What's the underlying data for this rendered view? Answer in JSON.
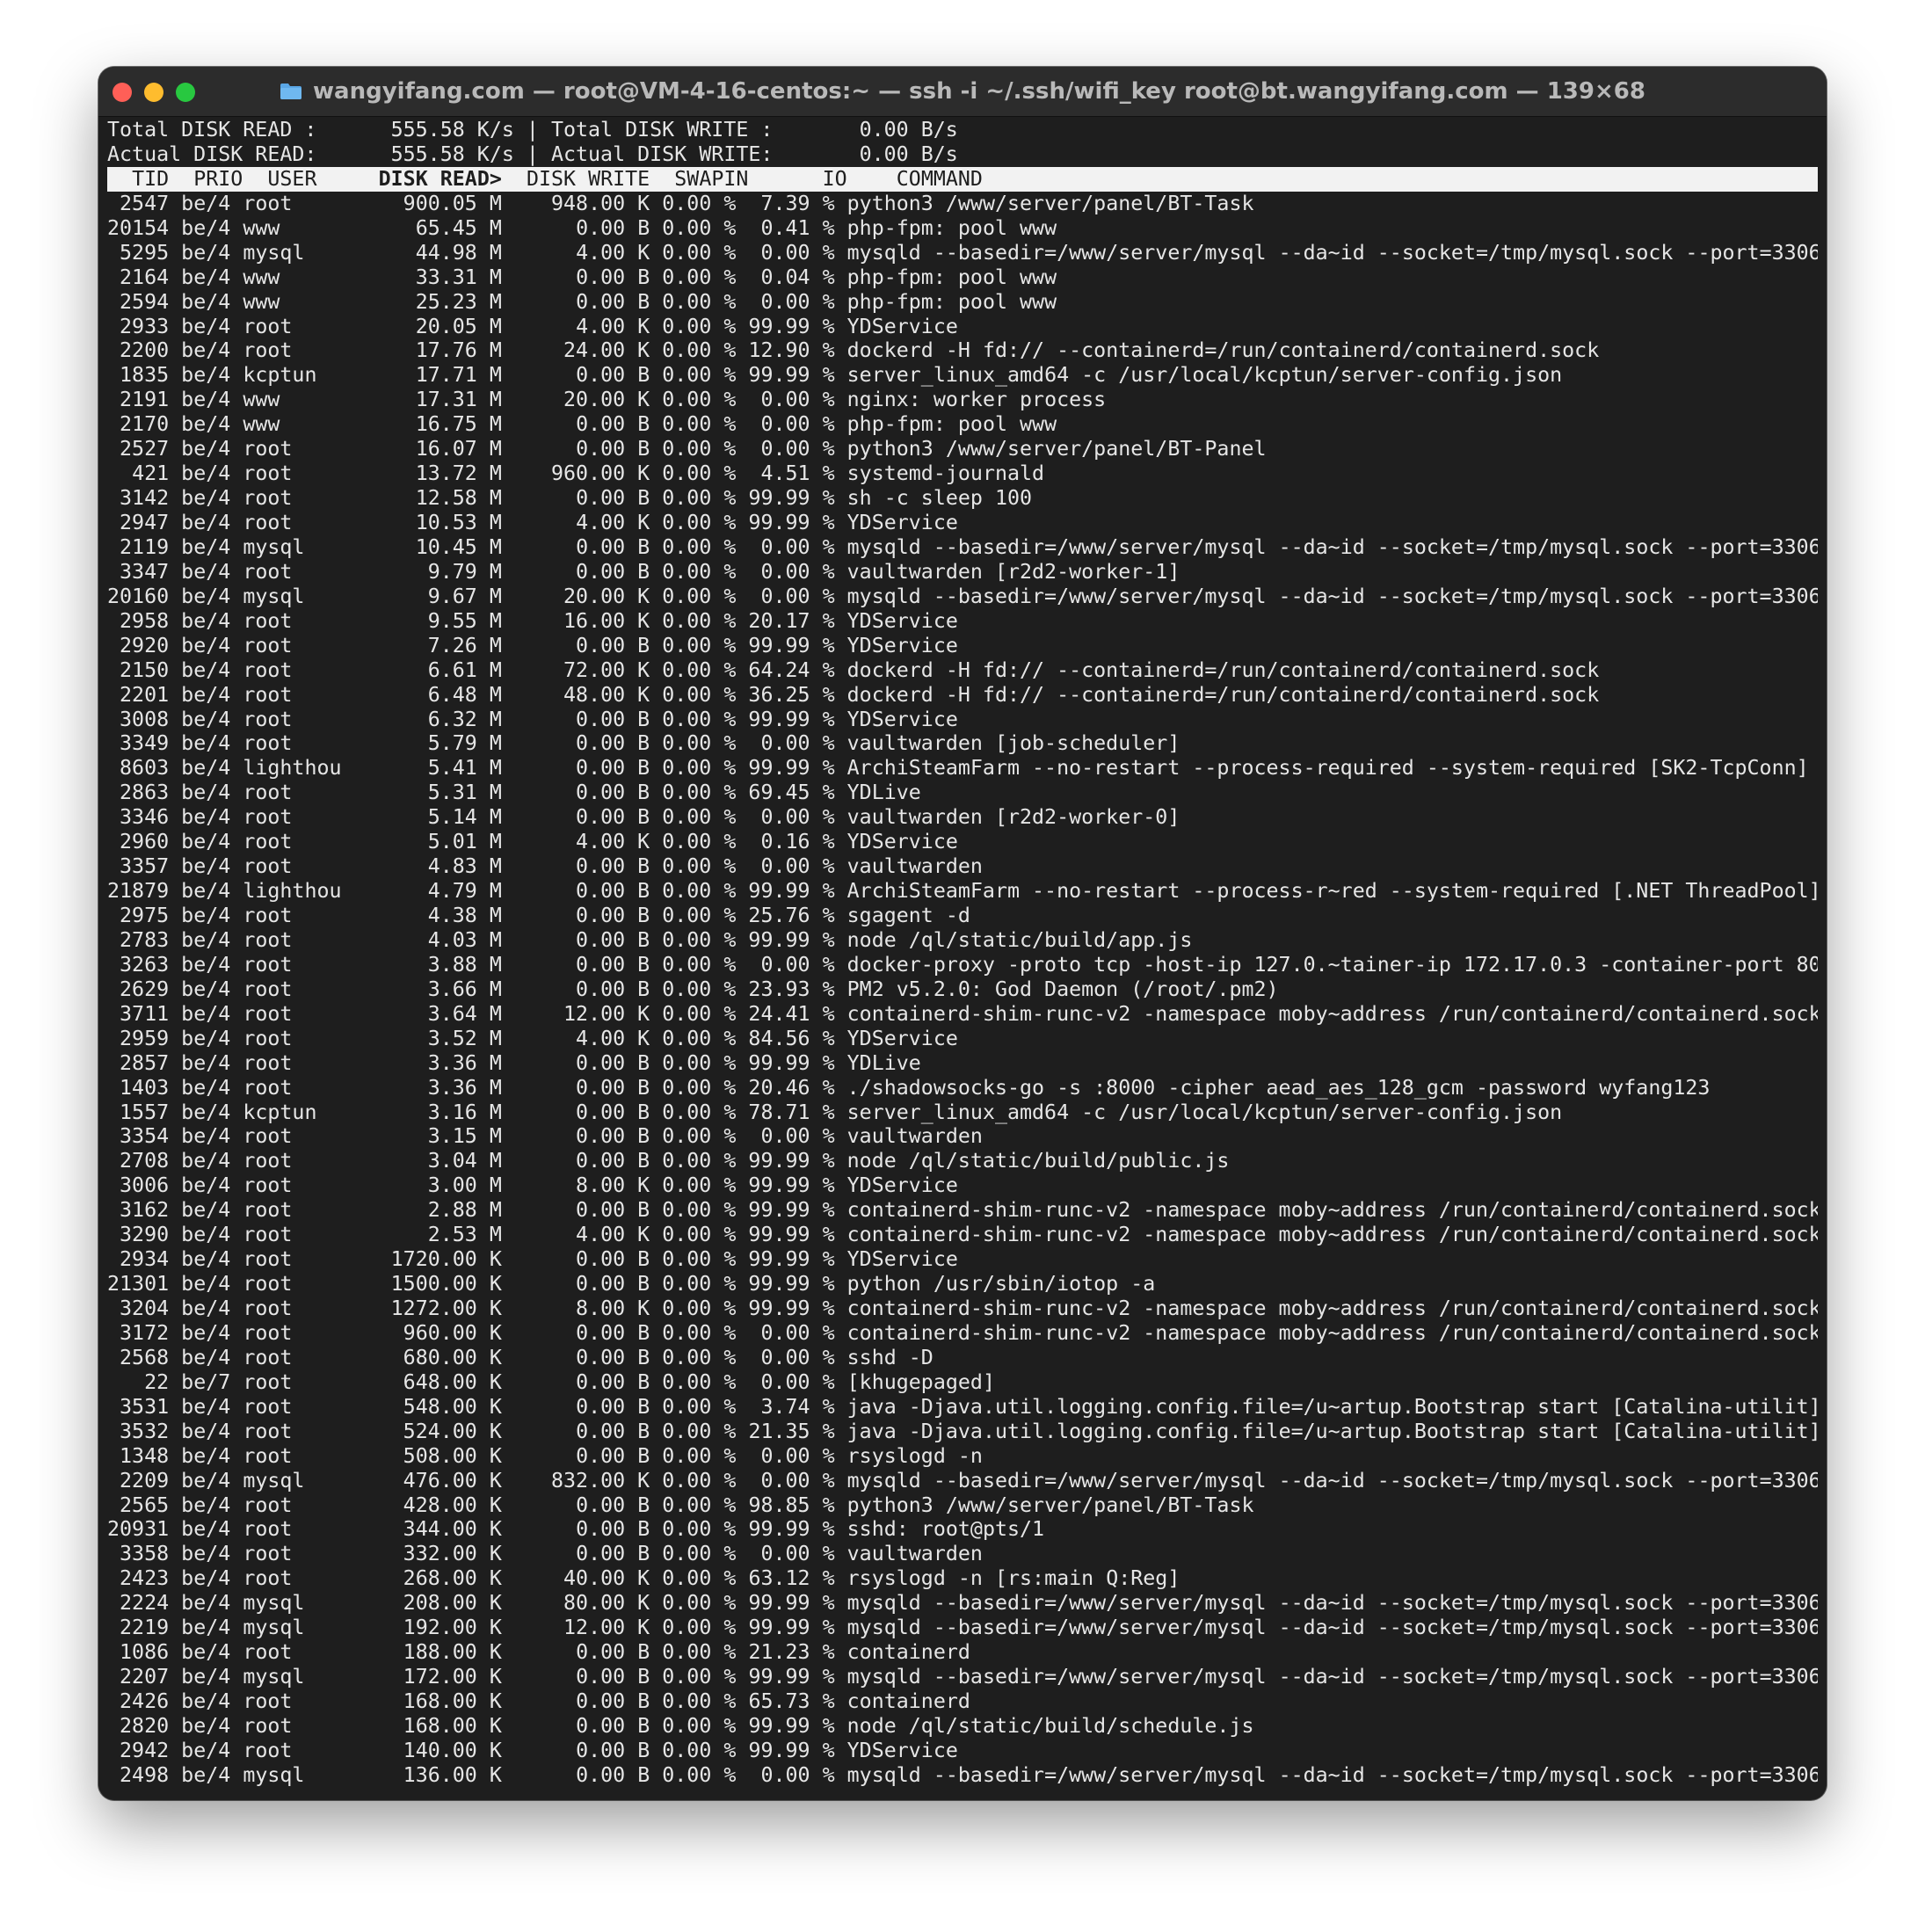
{
  "window": {
    "title": "wangyifang.com — root@VM-4-16-centos:~ — ssh -i ~/.ssh/wifi_key root@bt.wangyifang.com — 139×68"
  },
  "summary": {
    "total_read_label": "Total DISK READ :",
    "total_read_value": "555.58 K/s",
    "total_write_label": "Total DISK WRITE :",
    "total_write_value": "0.00 B/s",
    "actual_read_label": "Actual DISK READ:",
    "actual_read_value": "555.58 K/s",
    "actual_write_label": "Actual DISK WRITE:",
    "actual_write_value": "0.00 B/s"
  },
  "columns": {
    "tid": "TID",
    "prio": "PRIO",
    "user": "USER",
    "disk_read": "DISK READ>",
    "disk_write": "DISK WRITE",
    "swapin": "SWAPIN",
    "io": "IO",
    "command": "COMMAND"
  },
  "rows": [
    {
      "tid": "2547",
      "prio": "be/4",
      "user": "root",
      "read": "900.05 M",
      "write": "948.00 K",
      "swapin": "0.00 %",
      "io": "7.39 %",
      "command": "python3 /www/server/panel/BT-Task"
    },
    {
      "tid": "20154",
      "prio": "be/4",
      "user": "www",
      "read": "65.45 M",
      "write": "0.00 B",
      "swapin": "0.00 %",
      "io": "0.41 %",
      "command": "php-fpm: pool www"
    },
    {
      "tid": "5295",
      "prio": "be/4",
      "user": "mysql",
      "read": "44.98 M",
      "write": "4.00 K",
      "swapin": "0.00 %",
      "io": "0.00 %",
      "command": "mysqld --basedir=/www/server/mysql --da~id --socket=/tmp/mysql.sock --port=3306"
    },
    {
      "tid": "2164",
      "prio": "be/4",
      "user": "www",
      "read": "33.31 M",
      "write": "0.00 B",
      "swapin": "0.00 %",
      "io": "0.04 %",
      "command": "php-fpm: pool www"
    },
    {
      "tid": "2594",
      "prio": "be/4",
      "user": "www",
      "read": "25.23 M",
      "write": "0.00 B",
      "swapin": "0.00 %",
      "io": "0.00 %",
      "command": "php-fpm: pool www"
    },
    {
      "tid": "2933",
      "prio": "be/4",
      "user": "root",
      "read": "20.05 M",
      "write": "4.00 K",
      "swapin": "0.00 %",
      "io": "99.99 %",
      "command": "YDService"
    },
    {
      "tid": "2200",
      "prio": "be/4",
      "user": "root",
      "read": "17.76 M",
      "write": "24.00 K",
      "swapin": "0.00 %",
      "io": "12.90 %",
      "command": "dockerd -H fd:// --containerd=/run/containerd/containerd.sock"
    },
    {
      "tid": "1835",
      "prio": "be/4",
      "user": "kcptun",
      "read": "17.71 M",
      "write": "0.00 B",
      "swapin": "0.00 %",
      "io": "99.99 %",
      "command": "server_linux_amd64 -c /usr/local/kcptun/server-config.json"
    },
    {
      "tid": "2191",
      "prio": "be/4",
      "user": "www",
      "read": "17.31 M",
      "write": "20.00 K",
      "swapin": "0.00 %",
      "io": "0.00 %",
      "command": "nginx: worker process"
    },
    {
      "tid": "2170",
      "prio": "be/4",
      "user": "www",
      "read": "16.75 M",
      "write": "0.00 B",
      "swapin": "0.00 %",
      "io": "0.00 %",
      "command": "php-fpm: pool www"
    },
    {
      "tid": "2527",
      "prio": "be/4",
      "user": "root",
      "read": "16.07 M",
      "write": "0.00 B",
      "swapin": "0.00 %",
      "io": "0.00 %",
      "command": "python3 /www/server/panel/BT-Panel"
    },
    {
      "tid": "421",
      "prio": "be/4",
      "user": "root",
      "read": "13.72 M",
      "write": "960.00 K",
      "swapin": "0.00 %",
      "io": "4.51 %",
      "command": "systemd-journald"
    },
    {
      "tid": "3142",
      "prio": "be/4",
      "user": "root",
      "read": "12.58 M",
      "write": "0.00 B",
      "swapin": "0.00 %",
      "io": "99.99 %",
      "command": "sh -c sleep 100"
    },
    {
      "tid": "2947",
      "prio": "be/4",
      "user": "root",
      "read": "10.53 M",
      "write": "4.00 K",
      "swapin": "0.00 %",
      "io": "99.99 %",
      "command": "YDService"
    },
    {
      "tid": "2119",
      "prio": "be/4",
      "user": "mysql",
      "read": "10.45 M",
      "write": "0.00 B",
      "swapin": "0.00 %",
      "io": "0.00 %",
      "command": "mysqld --basedir=/www/server/mysql --da~id --socket=/tmp/mysql.sock --port=3306"
    },
    {
      "tid": "3347",
      "prio": "be/4",
      "user": "root",
      "read": "9.79 M",
      "write": "0.00 B",
      "swapin": "0.00 %",
      "io": "0.00 %",
      "command": "vaultwarden [r2d2-worker-1]"
    },
    {
      "tid": "20160",
      "prio": "be/4",
      "user": "mysql",
      "read": "9.67 M",
      "write": "20.00 K",
      "swapin": "0.00 %",
      "io": "0.00 %",
      "command": "mysqld --basedir=/www/server/mysql --da~id --socket=/tmp/mysql.sock --port=3306"
    },
    {
      "tid": "2958",
      "prio": "be/4",
      "user": "root",
      "read": "9.55 M",
      "write": "16.00 K",
      "swapin": "0.00 %",
      "io": "20.17 %",
      "command": "YDService"
    },
    {
      "tid": "2920",
      "prio": "be/4",
      "user": "root",
      "read": "7.26 M",
      "write": "0.00 B",
      "swapin": "0.00 %",
      "io": "99.99 %",
      "command": "YDService"
    },
    {
      "tid": "2150",
      "prio": "be/4",
      "user": "root",
      "read": "6.61 M",
      "write": "72.00 K",
      "swapin": "0.00 %",
      "io": "64.24 %",
      "command": "dockerd -H fd:// --containerd=/run/containerd/containerd.sock"
    },
    {
      "tid": "2201",
      "prio": "be/4",
      "user": "root",
      "read": "6.48 M",
      "write": "48.00 K",
      "swapin": "0.00 %",
      "io": "36.25 %",
      "command": "dockerd -H fd:// --containerd=/run/containerd/containerd.sock"
    },
    {
      "tid": "3008",
      "prio": "be/4",
      "user": "root",
      "read": "6.32 M",
      "write": "0.00 B",
      "swapin": "0.00 %",
      "io": "99.99 %",
      "command": "YDService"
    },
    {
      "tid": "3349",
      "prio": "be/4",
      "user": "root",
      "read": "5.79 M",
      "write": "0.00 B",
      "swapin": "0.00 %",
      "io": "0.00 %",
      "command": "vaultwarden [job-scheduler]"
    },
    {
      "tid": "8603",
      "prio": "be/4",
      "user": "lighthou",
      "read": "5.41 M",
      "write": "0.00 B",
      "swapin": "0.00 %",
      "io": "99.99 %",
      "command": "ArchiSteamFarm --no-restart --process-required --system-required [SK2-TcpConn]"
    },
    {
      "tid": "2863",
      "prio": "be/4",
      "user": "root",
      "read": "5.31 M",
      "write": "0.00 B",
      "swapin": "0.00 %",
      "io": "69.45 %",
      "command": "YDLive"
    },
    {
      "tid": "3346",
      "prio": "be/4",
      "user": "root",
      "read": "5.14 M",
      "write": "0.00 B",
      "swapin": "0.00 %",
      "io": "0.00 %",
      "command": "vaultwarden [r2d2-worker-0]"
    },
    {
      "tid": "2960",
      "prio": "be/4",
      "user": "root",
      "read": "5.01 M",
      "write": "4.00 K",
      "swapin": "0.00 %",
      "io": "0.16 %",
      "command": "YDService"
    },
    {
      "tid": "3357",
      "prio": "be/4",
      "user": "root",
      "read": "4.83 M",
      "write": "0.00 B",
      "swapin": "0.00 %",
      "io": "0.00 %",
      "command": "vaultwarden"
    },
    {
      "tid": "21879",
      "prio": "be/4",
      "user": "lighthou",
      "read": "4.79 M",
      "write": "0.00 B",
      "swapin": "0.00 %",
      "io": "99.99 %",
      "command": "ArchiSteamFarm --no-restart --process-r~red --system-required [.NET ThreadPool]"
    },
    {
      "tid": "2975",
      "prio": "be/4",
      "user": "root",
      "read": "4.38 M",
      "write": "0.00 B",
      "swapin": "0.00 %",
      "io": "25.76 %",
      "command": "sgagent -d"
    },
    {
      "tid": "2783",
      "prio": "be/4",
      "user": "root",
      "read": "4.03 M",
      "write": "0.00 B",
      "swapin": "0.00 %",
      "io": "99.99 %",
      "command": "node /ql/static/build/app.js"
    },
    {
      "tid": "3263",
      "prio": "be/4",
      "user": "root",
      "read": "3.88 M",
      "write": "0.00 B",
      "swapin": "0.00 %",
      "io": "0.00 %",
      "command": "docker-proxy -proto tcp -host-ip 127.0.~tainer-ip 172.17.0.3 -container-port 80"
    },
    {
      "tid": "2629",
      "prio": "be/4",
      "user": "root",
      "read": "3.66 M",
      "write": "0.00 B",
      "swapin": "0.00 %",
      "io": "23.93 %",
      "command": "PM2 v5.2.0: God Daemon (/root/.pm2)"
    },
    {
      "tid": "3711",
      "prio": "be/4",
      "user": "root",
      "read": "3.64 M",
      "write": "12.00 K",
      "swapin": "0.00 %",
      "io": "24.41 %",
      "command": "containerd-shim-runc-v2 -namespace moby~address /run/containerd/containerd.sock"
    },
    {
      "tid": "2959",
      "prio": "be/4",
      "user": "root",
      "read": "3.52 M",
      "write": "4.00 K",
      "swapin": "0.00 %",
      "io": "84.56 %",
      "command": "YDService"
    },
    {
      "tid": "2857",
      "prio": "be/4",
      "user": "root",
      "read": "3.36 M",
      "write": "0.00 B",
      "swapin": "0.00 %",
      "io": "99.99 %",
      "command": "YDLive"
    },
    {
      "tid": "1403",
      "prio": "be/4",
      "user": "root",
      "read": "3.36 M",
      "write": "0.00 B",
      "swapin": "0.00 %",
      "io": "20.46 %",
      "command": "./shadowsocks-go -s :8000 -cipher aead_aes_128_gcm -password wyfang123"
    },
    {
      "tid": "1557",
      "prio": "be/4",
      "user": "kcptun",
      "read": "3.16 M",
      "write": "0.00 B",
      "swapin": "0.00 %",
      "io": "78.71 %",
      "command": "server_linux_amd64 -c /usr/local/kcptun/server-config.json"
    },
    {
      "tid": "3354",
      "prio": "be/4",
      "user": "root",
      "read": "3.15 M",
      "write": "0.00 B",
      "swapin": "0.00 %",
      "io": "0.00 %",
      "command": "vaultwarden"
    },
    {
      "tid": "2708",
      "prio": "be/4",
      "user": "root",
      "read": "3.04 M",
      "write": "0.00 B",
      "swapin": "0.00 %",
      "io": "99.99 %",
      "command": "node /ql/static/build/public.js"
    },
    {
      "tid": "3006",
      "prio": "be/4",
      "user": "root",
      "read": "3.00 M",
      "write": "8.00 K",
      "swapin": "0.00 %",
      "io": "99.99 %",
      "command": "YDService"
    },
    {
      "tid": "3162",
      "prio": "be/4",
      "user": "root",
      "read": "2.88 M",
      "write": "0.00 B",
      "swapin": "0.00 %",
      "io": "99.99 %",
      "command": "containerd-shim-runc-v2 -namespace moby~address /run/containerd/containerd.sock"
    },
    {
      "tid": "3290",
      "prio": "be/4",
      "user": "root",
      "read": "2.53 M",
      "write": "4.00 K",
      "swapin": "0.00 %",
      "io": "99.99 %",
      "command": "containerd-shim-runc-v2 -namespace moby~address /run/containerd/containerd.sock"
    },
    {
      "tid": "2934",
      "prio": "be/4",
      "user": "root",
      "read": "1720.00 K",
      "write": "0.00 B",
      "swapin": "0.00 %",
      "io": "99.99 %",
      "command": "YDService"
    },
    {
      "tid": "21301",
      "prio": "be/4",
      "user": "root",
      "read": "1500.00 K",
      "write": "0.00 B",
      "swapin": "0.00 %",
      "io": "99.99 %",
      "command": "python /usr/sbin/iotop -a"
    },
    {
      "tid": "3204",
      "prio": "be/4",
      "user": "root",
      "read": "1272.00 K",
      "write": "8.00 K",
      "swapin": "0.00 %",
      "io": "99.99 %",
      "command": "containerd-shim-runc-v2 -namespace moby~address /run/containerd/containerd.sock"
    },
    {
      "tid": "3172",
      "prio": "be/4",
      "user": "root",
      "read": "960.00 K",
      "write": "0.00 B",
      "swapin": "0.00 %",
      "io": "0.00 %",
      "command": "containerd-shim-runc-v2 -namespace moby~address /run/containerd/containerd.sock"
    },
    {
      "tid": "2568",
      "prio": "be/4",
      "user": "root",
      "read": "680.00 K",
      "write": "0.00 B",
      "swapin": "0.00 %",
      "io": "0.00 %",
      "command": "sshd -D"
    },
    {
      "tid": "22",
      "prio": "be/7",
      "user": "root",
      "read": "648.00 K",
      "write": "0.00 B",
      "swapin": "0.00 %",
      "io": "0.00 %",
      "command": "[khugepaged]"
    },
    {
      "tid": "3531",
      "prio": "be/4",
      "user": "root",
      "read": "548.00 K",
      "write": "0.00 B",
      "swapin": "0.00 %",
      "io": "3.74 %",
      "command": "java -Djava.util.logging.config.file=/u~artup.Bootstrap start [Catalina-utilit]"
    },
    {
      "tid": "3532",
      "prio": "be/4",
      "user": "root",
      "read": "524.00 K",
      "write": "0.00 B",
      "swapin": "0.00 %",
      "io": "21.35 %",
      "command": "java -Djava.util.logging.config.file=/u~artup.Bootstrap start [Catalina-utilit]"
    },
    {
      "tid": "1348",
      "prio": "be/4",
      "user": "root",
      "read": "508.00 K",
      "write": "0.00 B",
      "swapin": "0.00 %",
      "io": "0.00 %",
      "command": "rsyslogd -n"
    },
    {
      "tid": "2209",
      "prio": "be/4",
      "user": "mysql",
      "read": "476.00 K",
      "write": "832.00 K",
      "swapin": "0.00 %",
      "io": "0.00 %",
      "command": "mysqld --basedir=/www/server/mysql --da~id --socket=/tmp/mysql.sock --port=3306"
    },
    {
      "tid": "2565",
      "prio": "be/4",
      "user": "root",
      "read": "428.00 K",
      "write": "0.00 B",
      "swapin": "0.00 %",
      "io": "98.85 %",
      "command": "python3 /www/server/panel/BT-Task"
    },
    {
      "tid": "20931",
      "prio": "be/4",
      "user": "root",
      "read": "344.00 K",
      "write": "0.00 B",
      "swapin": "0.00 %",
      "io": "99.99 %",
      "command": "sshd: root@pts/1"
    },
    {
      "tid": "3358",
      "prio": "be/4",
      "user": "root",
      "read": "332.00 K",
      "write": "0.00 B",
      "swapin": "0.00 %",
      "io": "0.00 %",
      "command": "vaultwarden"
    },
    {
      "tid": "2423",
      "prio": "be/4",
      "user": "root",
      "read": "268.00 K",
      "write": "40.00 K",
      "swapin": "0.00 %",
      "io": "63.12 %",
      "command": "rsyslogd -n [rs:main Q:Reg]"
    },
    {
      "tid": "2224",
      "prio": "be/4",
      "user": "mysql",
      "read": "208.00 K",
      "write": "80.00 K",
      "swapin": "0.00 %",
      "io": "99.99 %",
      "command": "mysqld --basedir=/www/server/mysql --da~id --socket=/tmp/mysql.sock --port=3306"
    },
    {
      "tid": "2219",
      "prio": "be/4",
      "user": "mysql",
      "read": "192.00 K",
      "write": "12.00 K",
      "swapin": "0.00 %",
      "io": "99.99 %",
      "command": "mysqld --basedir=/www/server/mysql --da~id --socket=/tmp/mysql.sock --port=3306"
    },
    {
      "tid": "1086",
      "prio": "be/4",
      "user": "root",
      "read": "188.00 K",
      "write": "0.00 B",
      "swapin": "0.00 %",
      "io": "21.23 %",
      "command": "containerd"
    },
    {
      "tid": "2207",
      "prio": "be/4",
      "user": "mysql",
      "read": "172.00 K",
      "write": "0.00 B",
      "swapin": "0.00 %",
      "io": "99.99 %",
      "command": "mysqld --basedir=/www/server/mysql --da~id --socket=/tmp/mysql.sock --port=3306"
    },
    {
      "tid": "2426",
      "prio": "be/4",
      "user": "root",
      "read": "168.00 K",
      "write": "0.00 B",
      "swapin": "0.00 %",
      "io": "65.73 %",
      "command": "containerd"
    },
    {
      "tid": "2820",
      "prio": "be/4",
      "user": "root",
      "read": "168.00 K",
      "write": "0.00 B",
      "swapin": "0.00 %",
      "io": "99.99 %",
      "command": "node /ql/static/build/schedule.js"
    },
    {
      "tid": "2942",
      "prio": "be/4",
      "user": "root",
      "read": "140.00 K",
      "write": "0.00 B",
      "swapin": "0.00 %",
      "io": "99.99 %",
      "command": "YDService"
    },
    {
      "tid": "2498",
      "prio": "be/4",
      "user": "mysql",
      "read": "136.00 K",
      "write": "0.00 B",
      "swapin": "0.00 %",
      "io": "0.00 %",
      "command": "mysqld --basedir=/www/server/mysql --da~id --socket=/tmp/mysql.sock --port=3306"
    }
  ],
  "colors": {
    "background": "#1e1e1e",
    "foreground": "#e6e6e6",
    "header_bg": "#f2f2f2",
    "close": "#ff5f57",
    "minimize": "#febc2e",
    "zoom": "#28c840",
    "folder": "#5aa7e6"
  },
  "icons": {
    "folder": "folder-icon"
  }
}
